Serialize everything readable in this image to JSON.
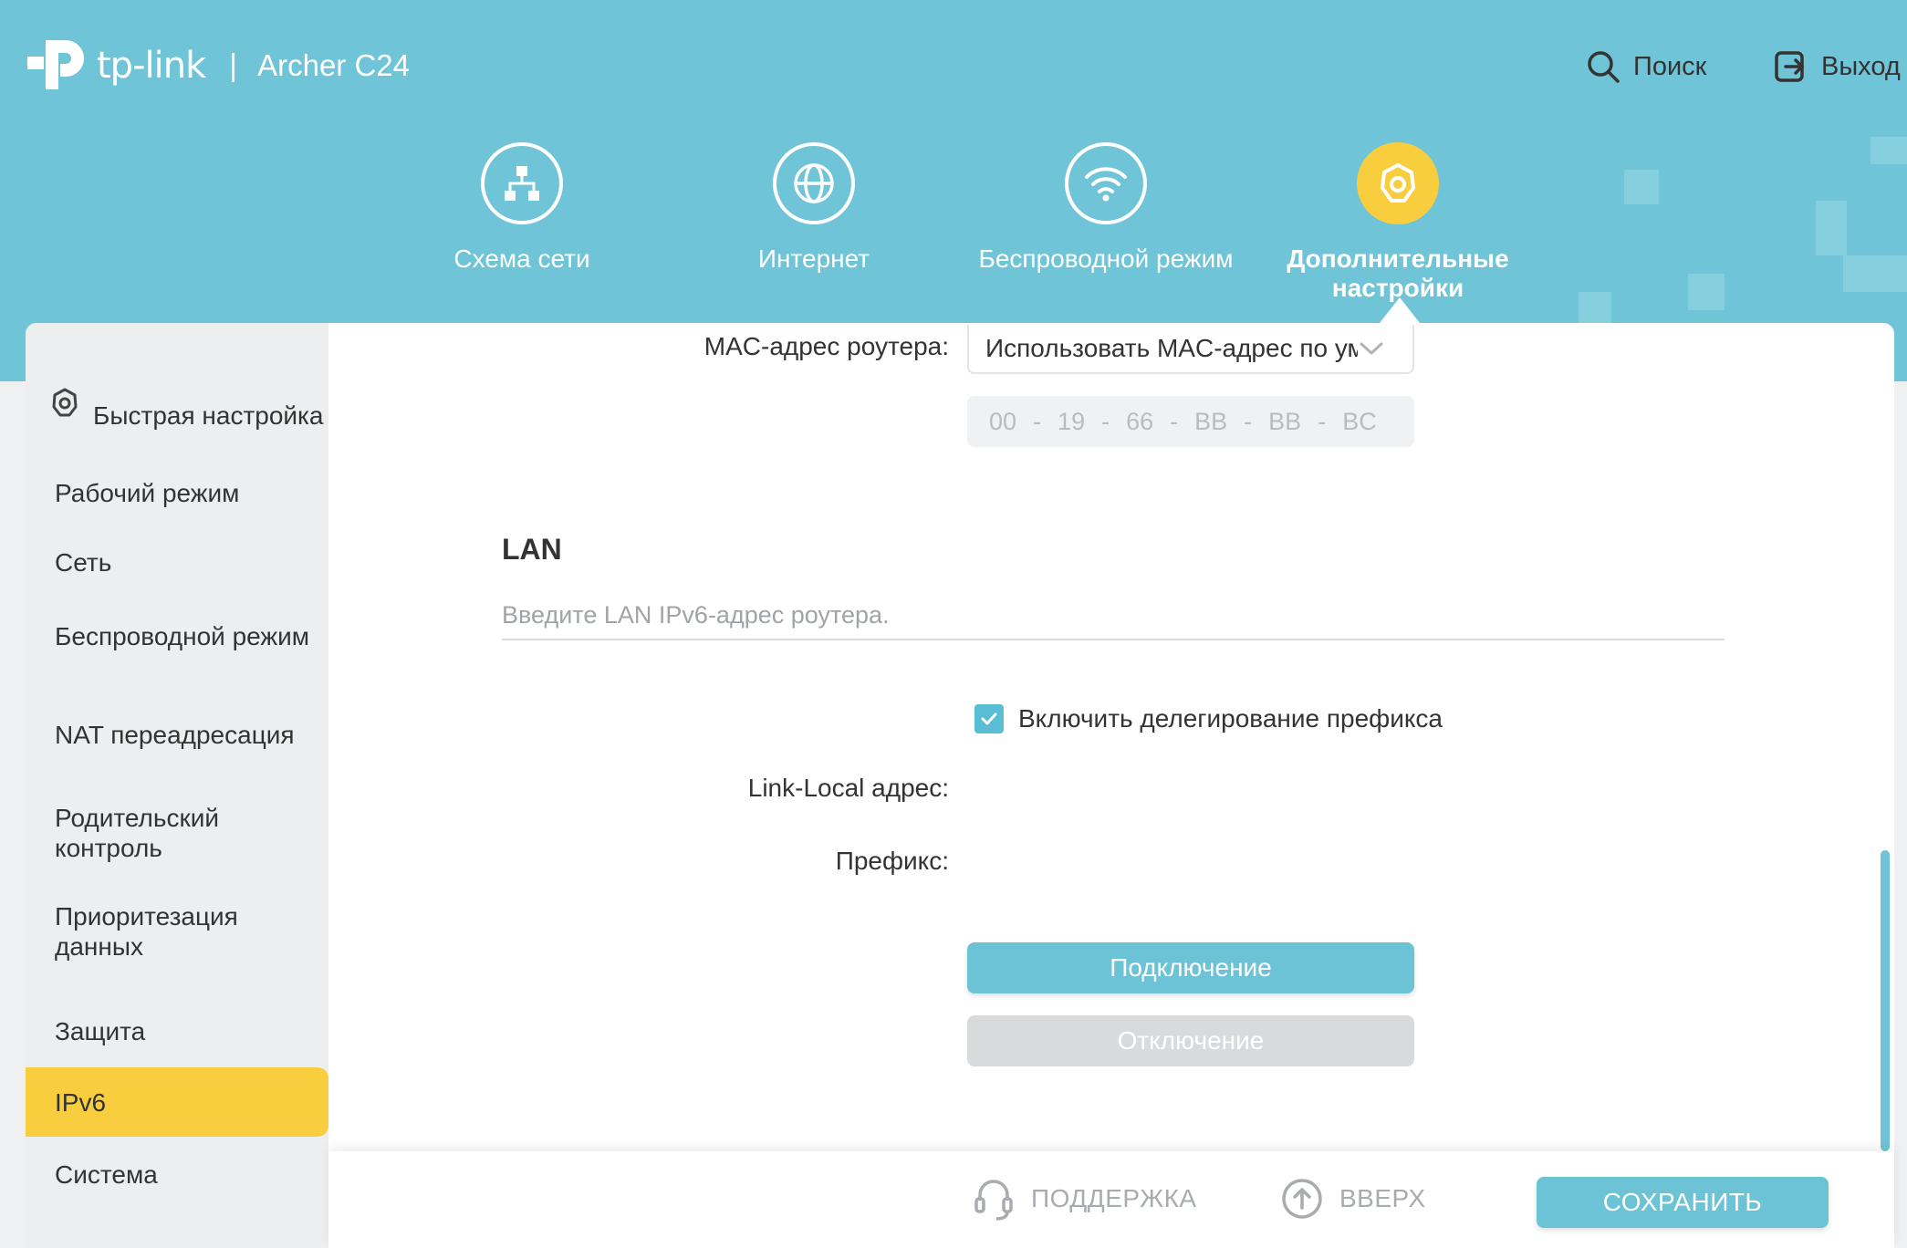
{
  "header": {
    "brand": "tp-link",
    "model": "Archer C24",
    "search_label": "Поиск",
    "logout_label": "Выход"
  },
  "nav": [
    {
      "label": "Схема сети",
      "icon": "network-map-icon"
    },
    {
      "label": "Интернет",
      "icon": "globe-icon"
    },
    {
      "label": "Беспроводной режим",
      "icon": "wifi-icon"
    },
    {
      "label": "Дополнительные настройки",
      "icon": "gear-icon",
      "active": true
    }
  ],
  "sidebar": {
    "items": [
      {
        "label": "Быстрая настройка"
      },
      {
        "label": "Рабочий режим"
      },
      {
        "label": "Сеть"
      },
      {
        "label": "Беспроводной режим"
      },
      {
        "label": "NAT переадресация"
      },
      {
        "label": "Родительский контроль"
      },
      {
        "label": "Приоритезация данных"
      },
      {
        "label": "Защита"
      },
      {
        "label": "IPv6",
        "active": true
      },
      {
        "label": "Система"
      }
    ]
  },
  "form": {
    "mac_label": "MAC-адрес роутера:",
    "mac_select_value": "Использовать MAC-адрес по ум",
    "mac_octets": [
      "00",
      "19",
      "66",
      "BB",
      "BB",
      "BC"
    ],
    "lan_title": "LAN",
    "lan_placeholder": "Введите LAN IPv6-адрес роутера.",
    "prefix_delegation_label": "Включить делегирование префикса",
    "prefix_delegation_checked": true,
    "link_local_label": "Link-Local адрес:",
    "prefix_label": "Префикс:",
    "connect_label": "Подключение",
    "disconnect_label": "Отключение"
  },
  "footer": {
    "support_label": "ПОДДЕРЖКА",
    "top_label": "ВВЕРХ",
    "save_label": "СОХРАНИТЬ"
  },
  "colors": {
    "header_bg": "#6fc4d7",
    "accent_yellow": "#f8ce3f",
    "button_blue": "#6cc3d6",
    "disabled_gray": "#d8dadc"
  }
}
